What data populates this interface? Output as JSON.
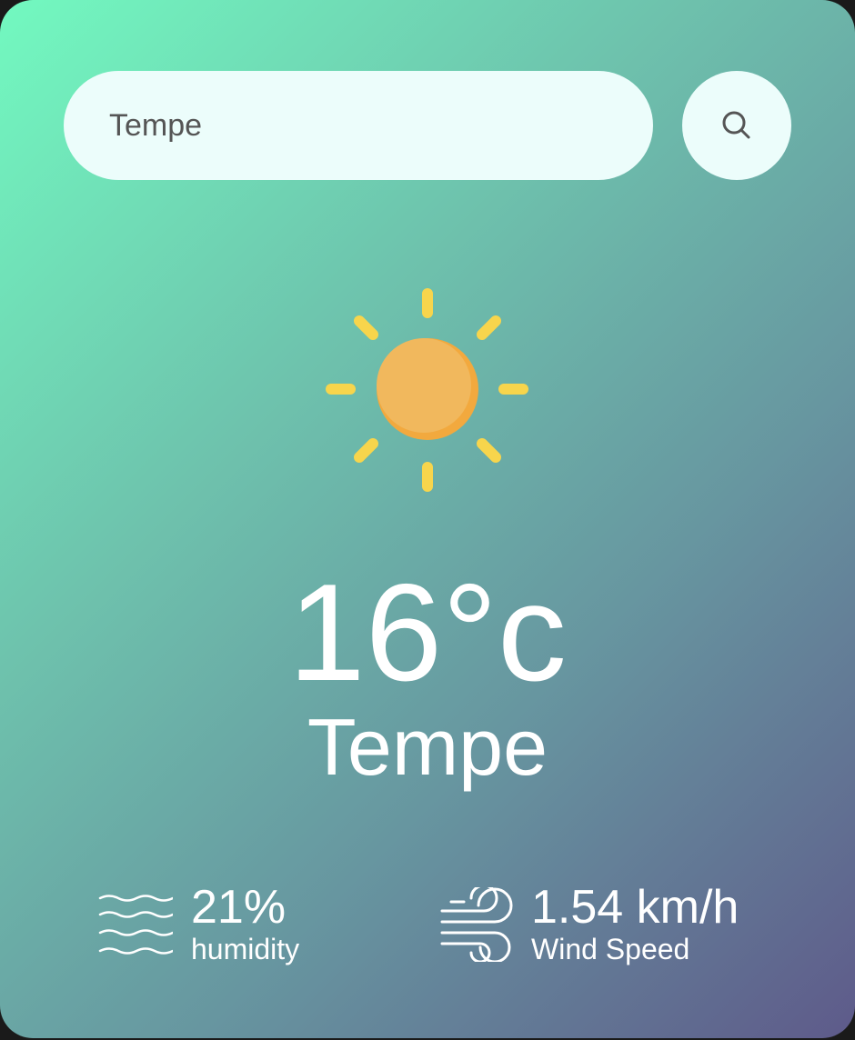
{
  "search": {
    "value": "Tempe",
    "button_icon": "search-icon"
  },
  "weather": {
    "icon": "sun-icon",
    "temperature": "16°c",
    "city": "Tempe"
  },
  "humidity": {
    "icon": "humidity-waves-icon",
    "value": "21%",
    "label": "humidity"
  },
  "wind": {
    "icon": "wind-icon",
    "value": "1.54 km/h",
    "label": "Wind Speed"
  },
  "colors": {
    "gradient_start": "#72f9c0",
    "gradient_end": "#5e5a8a",
    "input_bg": "#ecfdfb",
    "sun_core": "#f0b55a",
    "sun_rays": "#f7d54c"
  }
}
